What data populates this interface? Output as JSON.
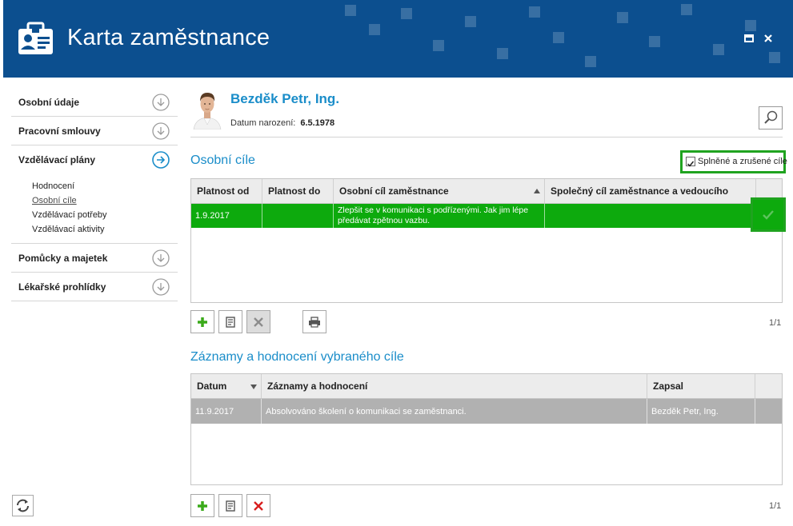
{
  "window": {
    "title": "Karta zaměstnance"
  },
  "sidebar": {
    "sections": [
      {
        "label": "Osobní údaje"
      },
      {
        "label": "Pracovní smlouvy"
      },
      {
        "label": "Vzdělávací plány",
        "expanded": true
      },
      {
        "label": "Pomůcky a majetek"
      },
      {
        "label": "Lékařské prohlídky"
      }
    ],
    "subitems": [
      {
        "label": "Hodnocení"
      },
      {
        "label": "Osobní cíle",
        "active": true
      },
      {
        "label": "Vzdělávací potřeby"
      },
      {
        "label": "Vzdělávací aktivity"
      }
    ]
  },
  "employee": {
    "name": "Bezděk Petr, Ing.",
    "birth_label": "Datum narození:",
    "birth_value": "6.5.1978"
  },
  "goals": {
    "title": "Osobní cíle",
    "filter_label": "Splněné a zrušené cíle",
    "filter_checked": true,
    "columns": [
      "Platnost od",
      "Platnost do",
      "Osobní cíl zaměstnance",
      "Společný cíl zaměstnance a vedoucího"
    ],
    "rows": [
      {
        "valid_from": "1.9.2017",
        "valid_to": "",
        "goal": "Zlepšit se v komunikaci s podřízenými. Jak jim lépe předávat zpětnou vazbu.",
        "shared_goal": "",
        "status": "completed"
      }
    ],
    "pager": "1/1"
  },
  "records": {
    "title": "Záznamy a hodnocení vybraného cíle",
    "columns": [
      "Datum",
      "Záznamy a hodnocení",
      "Zapsal"
    ],
    "rows": [
      {
        "date": "11.9.2017",
        "record": "Absolvováno školení o komunikaci se zaměstnanci.",
        "author": "Bezděk Petr, Ing."
      }
    ],
    "pager": "1/1"
  },
  "colors": {
    "header": "#0c4f8f",
    "accent": "#1a8dc9",
    "selected_row": "#0daa0d",
    "highlight_border": "#1fa31f",
    "grey_row": "#b1b1b1"
  },
  "icons": [
    "id-card-icon",
    "maximize-icon",
    "close-icon",
    "arrow-down-circle-icon",
    "arrow-right-circle-icon",
    "search-icon",
    "add-icon",
    "edit-icon",
    "delete-icon",
    "print-icon",
    "refresh-icon",
    "checkmark-icon",
    "sort-ascending-icon",
    "sort-descending-icon"
  ]
}
